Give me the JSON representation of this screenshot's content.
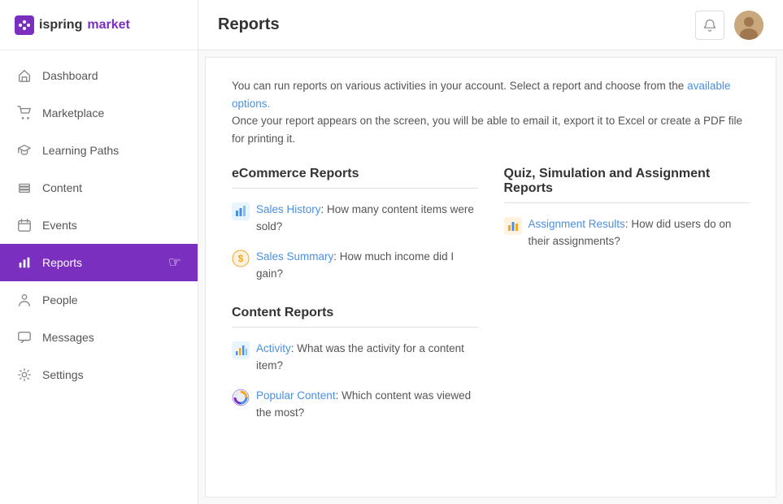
{
  "brand": {
    "name_part1": "ispring",
    "name_part2": "market"
  },
  "sidebar": {
    "items": [
      {
        "id": "dashboard",
        "label": "Dashboard",
        "icon": "home"
      },
      {
        "id": "marketplace",
        "label": "Marketplace",
        "icon": "cart"
      },
      {
        "id": "learning-paths",
        "label": "Learning Paths",
        "icon": "graduation"
      },
      {
        "id": "content",
        "label": "Content",
        "icon": "layers"
      },
      {
        "id": "events",
        "label": "Events",
        "icon": "calendar"
      },
      {
        "id": "reports",
        "label": "Reports",
        "icon": "bar-chart",
        "active": true
      },
      {
        "id": "people",
        "label": "People",
        "icon": "person"
      },
      {
        "id": "messages",
        "label": "Messages",
        "icon": "message"
      },
      {
        "id": "settings",
        "label": "Settings",
        "icon": "gear"
      }
    ]
  },
  "header": {
    "title": "Reports",
    "bell_label": "Notifications"
  },
  "content": {
    "intro_line1": "You can run reports on various activities in your account. Select a report and choose from the available options.",
    "intro_line2": "Once your report appears on the screen, you will be able to email it, export it to Excel or create a PDF file for printing it.",
    "ecommerce_section": {
      "heading": "eCommerce Reports",
      "items": [
        {
          "id": "sales-history",
          "link_text": "Sales History",
          "description": ": How many content items were sold?"
        },
        {
          "id": "sales-summary",
          "link_text": "Sales Summary",
          "description": ": How much income did I gain?"
        }
      ]
    },
    "content_reports_section": {
      "heading": "Content Reports",
      "items": [
        {
          "id": "activity",
          "link_text": "Activity",
          "description": ": What was the activity for a content item?"
        },
        {
          "id": "popular-content",
          "link_text": "Popular Content",
          "description": ": Which content was viewed the most?"
        }
      ]
    },
    "quiz_section": {
      "heading": "Quiz, Simulation and Assignment Reports",
      "items": [
        {
          "id": "assignment-results",
          "link_text": "Assignment Results",
          "description": ": How did users do on their assignments?"
        }
      ]
    }
  }
}
